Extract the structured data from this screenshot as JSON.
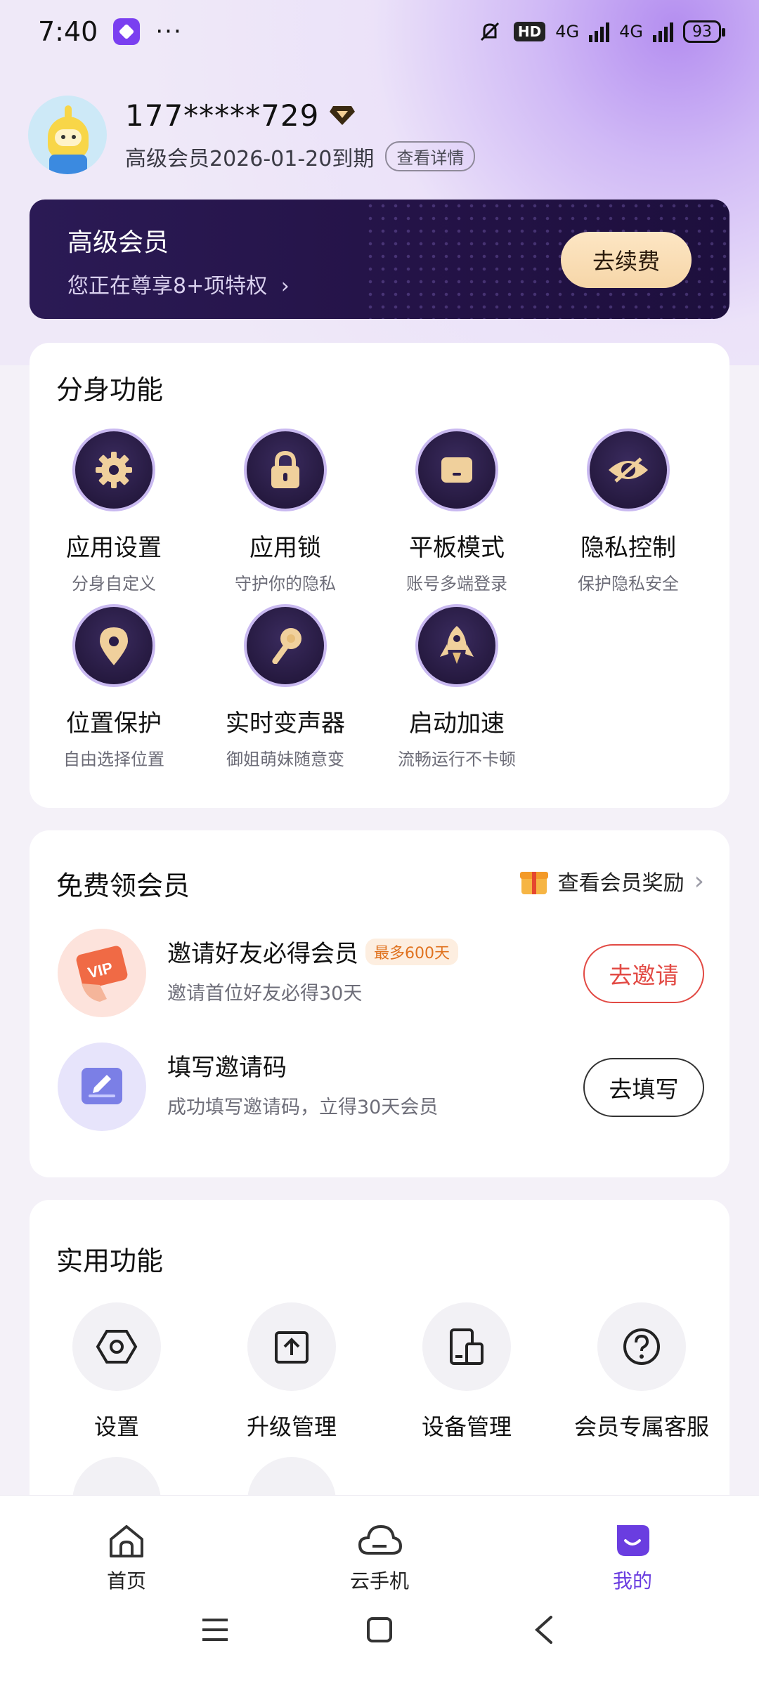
{
  "status_bar": {
    "time": "7:40",
    "more": "···",
    "hd": "HD",
    "net1": "4G",
    "net2": "4G",
    "battery": "93"
  },
  "profile": {
    "phone": "177*****729",
    "expire_text": "高级会员2026-01-20到期",
    "detail_button": "查看详情"
  },
  "vip_banner": {
    "title": "高级会员",
    "subtitle": "您正在尊享8+项特权",
    "arrow": "›",
    "renew_button": "去续费"
  },
  "clone_features": {
    "title": "分身功能",
    "items": [
      {
        "name": "应用设置",
        "desc": "分身自定义",
        "icon": "gear-icon"
      },
      {
        "name": "应用锁",
        "desc": "守护你的隐私",
        "icon": "lock-icon"
      },
      {
        "name": "平板模式",
        "desc": "账号多端登录",
        "icon": "tablet-icon"
      },
      {
        "name": "隐私控制",
        "desc": "保护隐私安全",
        "icon": "eye-off-icon"
      },
      {
        "name": "位置保护",
        "desc": "自由选择位置",
        "icon": "location-pin-icon"
      },
      {
        "name": "实时变声器",
        "desc": "御姐萌妹随意变",
        "icon": "microphone-icon"
      },
      {
        "name": "启动加速",
        "desc": "流畅运行不卡顿",
        "icon": "rocket-icon"
      }
    ]
  },
  "free_membership": {
    "title": "免费领会员",
    "reward_link": "查看会员奖励",
    "rows": [
      {
        "title": "邀请好友必得会员",
        "badge": "最多600天",
        "desc": "邀请首位好友必得30天",
        "button": "去邀请",
        "icon_text": "VIP"
      },
      {
        "title": "填写邀请码",
        "desc": "成功填写邀请码，立得30天会员",
        "button": "去填写"
      }
    ]
  },
  "tools": {
    "title": "实用功能",
    "items": [
      {
        "name": "设置",
        "icon": "settings-hexagon-icon"
      },
      {
        "name": "升级管理",
        "icon": "upgrade-icon"
      },
      {
        "name": "设备管理",
        "icon": "device-icon"
      },
      {
        "name": "会员专属客服",
        "icon": "help-icon"
      }
    ]
  },
  "bottom_nav": {
    "items": [
      {
        "label": "首页",
        "icon": "home-icon"
      },
      {
        "label": "云手机",
        "icon": "cloud-icon"
      },
      {
        "label": "我的",
        "icon": "profile-icon"
      }
    ],
    "active_index": 2
  },
  "colors": {
    "accent": "#6a3de0",
    "vip_dark": "#241347",
    "gold": "#f6d6a8",
    "invite_red": "#e24a44"
  }
}
